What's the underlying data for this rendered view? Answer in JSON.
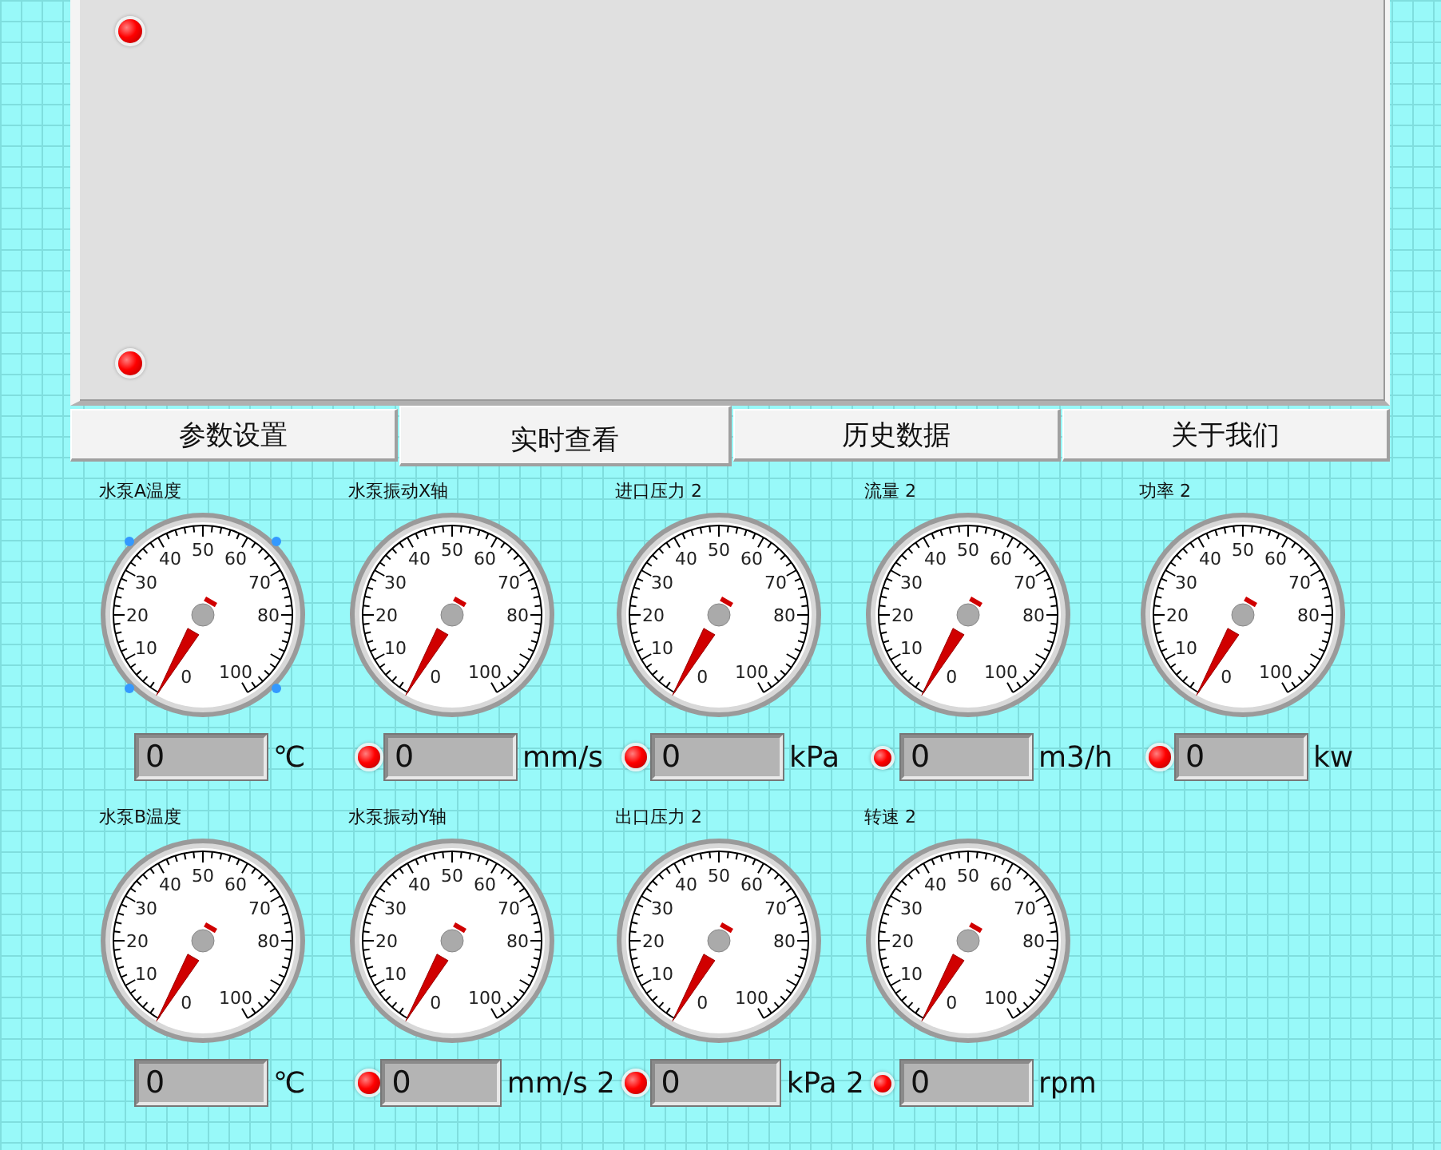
{
  "top_panel": {
    "leds": [
      {
        "on": true
      },
      {
        "on": true
      }
    ]
  },
  "tabs": [
    {
      "label": "参数设置",
      "selected": false
    },
    {
      "label": "实时查看",
      "selected": true
    },
    {
      "label": "历史数据",
      "selected": false
    },
    {
      "label": "关于我们",
      "selected": false
    }
  ],
  "gauge_rows": [
    {
      "gauges": [
        {
          "label": "水泵A温度",
          "selected": true,
          "scale": [
            "0",
            "10",
            "20",
            "30",
            "40",
            "50",
            "60",
            "70",
            "80",
            "100"
          ],
          "readout": {
            "value": "0",
            "unit": "℃"
          }
        },
        {
          "label": "水泵振动X轴",
          "selected": false,
          "scale": [
            "0",
            "10",
            "20",
            "30",
            "40",
            "50",
            "60",
            "70",
            "80",
            "100"
          ],
          "readout": {
            "value": "0",
            "unit": "mm/s",
            "led": {
              "on": true
            }
          }
        },
        {
          "label": "进口压力 2",
          "selected": false,
          "scale": [
            "0",
            "10",
            "20",
            "30",
            "40",
            "50",
            "60",
            "70",
            "80",
            "100"
          ],
          "readout": {
            "value": "0",
            "unit": "kPa",
            "led": {
              "on": true
            }
          }
        },
        {
          "label": "流量 2",
          "selected": false,
          "scale": [
            "0",
            "10",
            "20",
            "30",
            "40",
            "50",
            "60",
            "70",
            "80",
            "100"
          ],
          "readout": {
            "value": "0",
            "unit": "m3/h",
            "led": {
              "on": true
            }
          }
        },
        {
          "label": "功率 2",
          "selected": false,
          "scale": [
            "0",
            "10",
            "20",
            "30",
            "40",
            "50",
            "60",
            "70",
            "80",
            "100"
          ],
          "readout": {
            "value": "0",
            "unit": "kw",
            "led": {
              "on": true
            }
          }
        }
      ]
    },
    {
      "gauges": [
        {
          "label": "水泵B温度",
          "selected": false,
          "scale": [
            "0",
            "10",
            "20",
            "30",
            "40",
            "50",
            "60",
            "70",
            "80",
            "100"
          ],
          "readout": {
            "value": "0",
            "unit": "℃"
          }
        },
        {
          "label": "水泵振动Y轴",
          "selected": false,
          "scale": [
            "0",
            "10",
            "20",
            "30",
            "40",
            "50",
            "60",
            "70",
            "80",
            "100"
          ],
          "readout": {
            "value": "0",
            "unit": "mm/s 2",
            "led": {
              "on": true
            }
          }
        },
        {
          "label": "出口压力 2",
          "selected": false,
          "scale": [
            "0",
            "10",
            "20",
            "30",
            "40",
            "50",
            "60",
            "70",
            "80",
            "100"
          ],
          "readout": {
            "value": "0",
            "unit": "kPa 2",
            "led": {
              "on": true
            }
          }
        },
        {
          "label": "转速 2",
          "selected": false,
          "scale": [
            "0",
            "10",
            "20",
            "30",
            "40",
            "50",
            "60",
            "70",
            "80",
            "100"
          ],
          "readout": {
            "value": "0",
            "unit": "rpm",
            "led": {
              "on": true
            }
          }
        }
      ]
    }
  ]
}
